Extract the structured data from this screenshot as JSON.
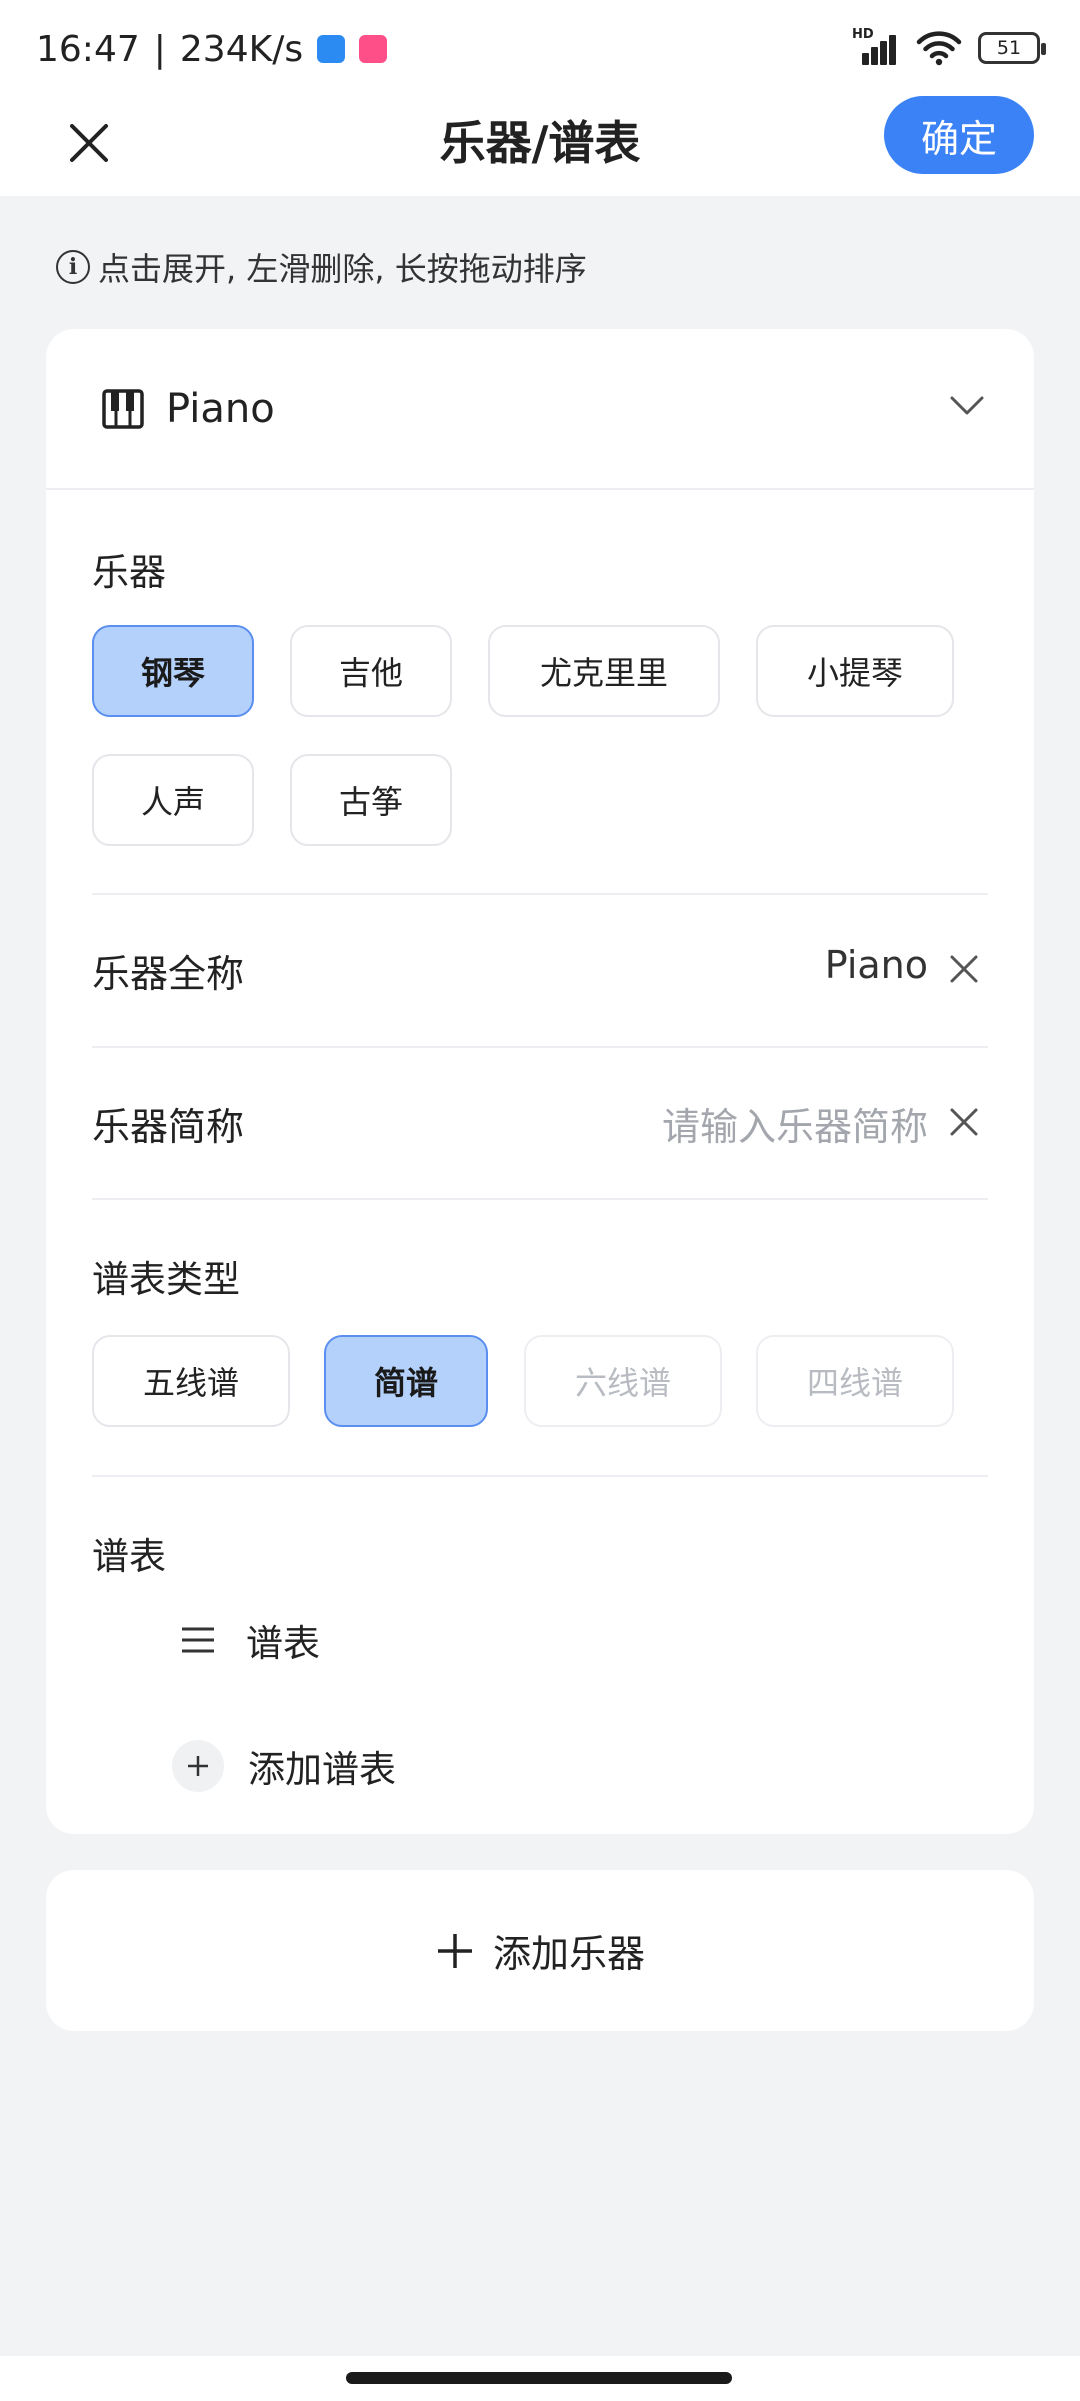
{
  "status_bar": {
    "time": "16:47",
    "speed": "234K/s",
    "battery": "51"
  },
  "header": {
    "title": "乐器/谱表",
    "confirm_label": "确定"
  },
  "hint": "点击展开, 左滑删除, 长按拖动排序",
  "card": {
    "title": "Piano",
    "instrument_section_label": "乐器",
    "instruments": [
      "钢琴",
      "吉他",
      "尤克里里",
      "小提琴",
      "人声",
      "古筝"
    ],
    "selected_instrument": "钢琴",
    "full_name_label": "乐器全称",
    "full_name_value": "Piano",
    "short_name_label": "乐器简称",
    "short_name_placeholder": "请输入乐器简称",
    "score_type_label": "谱表类型",
    "score_types": [
      "五线谱",
      "简谱",
      "六线谱",
      "四线谱"
    ],
    "selected_score_type": "简谱",
    "staff_section_label": "谱表",
    "staff_item": "谱表",
    "add_staff_label": "添加谱表"
  },
  "add_instrument_label": "添加乐器"
}
